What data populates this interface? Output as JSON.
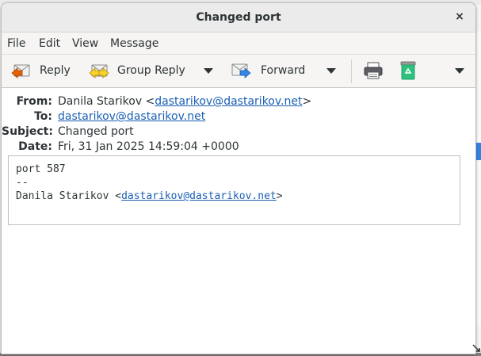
{
  "window": {
    "title": "Changed port",
    "close_glyph": "×"
  },
  "menu": {
    "items": [
      "File",
      "Edit",
      "View",
      "Message"
    ]
  },
  "toolbar": {
    "reply_label": "Reply",
    "group_reply_label": "Group Reply",
    "forward_label": "Forward",
    "icons": {
      "reply": "reply-icon",
      "group_reply": "group-reply-icon",
      "forward": "forward-icon",
      "print": "print-icon",
      "junk": "recycle-junk-icon"
    }
  },
  "headers": {
    "from_label": "From:",
    "from_name": "Danila Starikov <",
    "from_email": "dastarikov@dastarikov.net",
    "from_end": ">",
    "to_label": "To:",
    "to_email": "dastarikov@dastarikov.net",
    "subject_label": "Subject:",
    "subject": "Changed port",
    "date_label": "Date:",
    "date": "Fri, 31 Jan 2025 14:59:04 +0000"
  },
  "message": {
    "line1": "port 587",
    "line2": "--",
    "sig_name": "Danila Starikov <",
    "sig_email": "dastarikov@dastarikov.net",
    "sig_end": ">"
  },
  "colors": {
    "link": "#1a5fb4",
    "junk_green": "#2ec27e",
    "selection_blue": "#3584e4"
  }
}
